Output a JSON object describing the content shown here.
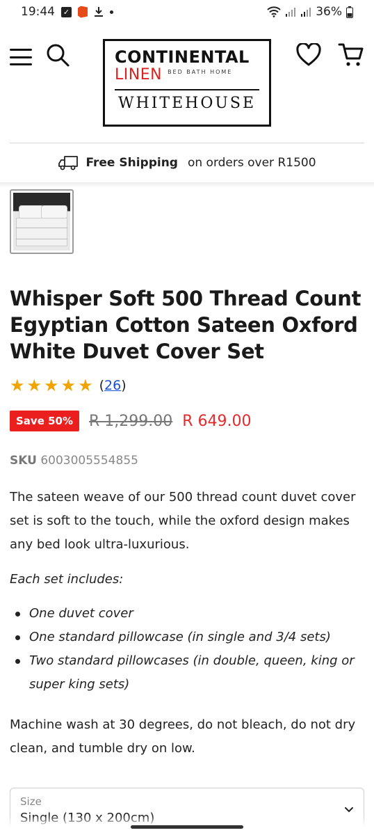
{
  "status_bar": {
    "time": "19:44",
    "battery": "36%"
  },
  "header": {
    "logo_line1": "CONTINENTAL",
    "logo_line2": "LINEN",
    "logo_tagline": "BED BATH HOME",
    "logo_line3": "WHITEHOUSE"
  },
  "shipping": {
    "bold_text": "Free Shipping",
    "rest_text": "on orders over R1500"
  },
  "product": {
    "title": "Whisper Soft 500 Thread Count Egyptian Cotton Sateen Oxford White Duvet Cover Set",
    "rating": 5,
    "review_count": "26",
    "paren_open": "(",
    "paren_close": ")",
    "save_badge": "Save 50%",
    "old_price": "R 1,299.00",
    "new_price": "R 649.00",
    "sku_label": "SKU",
    "sku_value": "6003005554855",
    "description": "The sateen weave of our 500 thread count duvet cover set is soft to the touch, while the oxford design makes any bed look ultra-luxurious.",
    "includes_heading": "Each set includes:",
    "includes": [
      "One duvet cover",
      "One standard pillowcase (in single and 3/4 sets)",
      "Two standard pillowcases (in double, queen, king or super king sets)"
    ],
    "care": "Machine wash at 30 degrees, do not bleach, do not dry clean, and tumble dry on low."
  },
  "size_select": {
    "label": "Size",
    "value": "Single (130 x 200cm)"
  },
  "colors": {
    "save_badge": "#ec1f1f",
    "sale_price": "#e42b2b",
    "star": "#f1a300",
    "link": "#1a4fcf"
  }
}
